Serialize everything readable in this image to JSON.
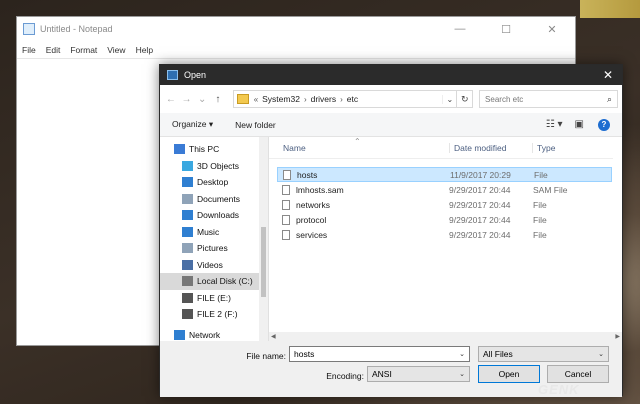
{
  "notepad": {
    "title": "Untitled - Notepad",
    "controls": {
      "minimize": "—",
      "maximize": "☐",
      "close": "✕"
    },
    "menu": [
      "File",
      "Edit",
      "Format",
      "View",
      "Help"
    ]
  },
  "dialog": {
    "title": "Open",
    "close": "✕",
    "nav": {
      "back": "←",
      "forward": "→",
      "recent": "⌄",
      "up": "↑"
    },
    "address": {
      "overflow": "«",
      "crumbs": [
        "System32",
        "drivers",
        "etc"
      ],
      "separator": "›"
    },
    "refresh": "↻",
    "search": {
      "placeholder": "Search etc"
    },
    "toolbar": {
      "organize": "Organize ▾",
      "new_folder": "New folder"
    },
    "nav_pane": [
      {
        "label": "This PC",
        "icon": "this-pc-icon",
        "color": "#3a7bd5"
      },
      {
        "label": "3D Objects",
        "icon": "3d-objects-icon",
        "color": "#3aa8e0"
      },
      {
        "label": "Desktop",
        "icon": "desktop-icon",
        "color": "#2f7fd1"
      },
      {
        "label": "Documents",
        "icon": "documents-icon",
        "color": "#8fa3b8"
      },
      {
        "label": "Downloads",
        "icon": "downloads-icon",
        "color": "#2f7fd1"
      },
      {
        "label": "Music",
        "icon": "music-icon",
        "color": "#2f7fd1"
      },
      {
        "label": "Pictures",
        "icon": "pictures-icon",
        "color": "#8fa3b8"
      },
      {
        "label": "Videos",
        "icon": "videos-icon",
        "color": "#4a6fa5"
      },
      {
        "label": "Local Disk (C:)",
        "icon": "local-disk-icon",
        "color": "#777777"
      },
      {
        "label": "FILE (E:)",
        "icon": "drive-icon",
        "color": "#555555"
      },
      {
        "label": "FILE 2 (F:)",
        "icon": "drive-icon",
        "color": "#555555"
      },
      {
        "label": "Network",
        "icon": "network-icon",
        "color": "#2f7fd1"
      }
    ],
    "columns": {
      "name": "Name",
      "date": "Date modified",
      "type": "Type"
    },
    "files": [
      {
        "name": "hosts",
        "date": "11/9/2017 20:29",
        "type": "File"
      },
      {
        "name": "lmhosts.sam",
        "date": "9/29/2017 20:44",
        "type": "SAM File"
      },
      {
        "name": "networks",
        "date": "9/29/2017 20:44",
        "type": "File"
      },
      {
        "name": "protocol",
        "date": "9/29/2017 20:44",
        "type": "File"
      },
      {
        "name": "services",
        "date": "9/29/2017 20:44",
        "type": "File"
      }
    ],
    "bottom": {
      "file_name_label": "File name:",
      "file_name_value": "hosts",
      "filter_value": "All Files",
      "encoding_label": "Encoding:",
      "encoding_value": "ANSI",
      "open_label": "Open",
      "cancel_label": "Cancel"
    }
  },
  "watermark": "GENK"
}
